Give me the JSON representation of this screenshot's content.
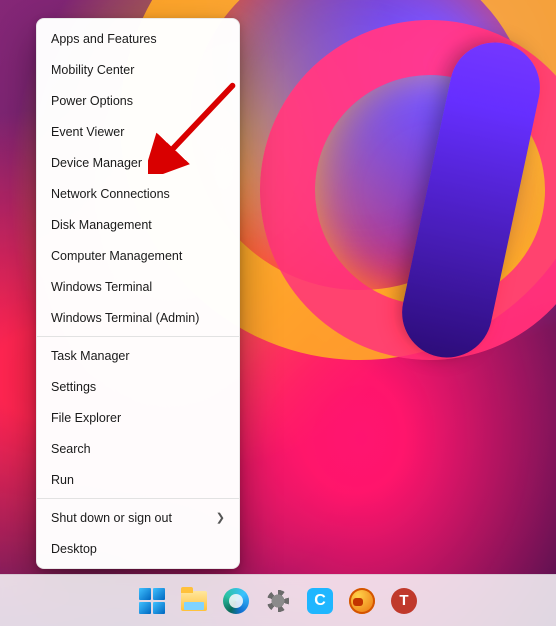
{
  "context_menu": {
    "groups": [
      [
        {
          "id": "apps-features",
          "label": "Apps and Features"
        },
        {
          "id": "mobility-center",
          "label": "Mobility Center"
        },
        {
          "id": "power-options",
          "label": "Power Options"
        },
        {
          "id": "event-viewer",
          "label": "Event Viewer"
        },
        {
          "id": "device-manager",
          "label": "Device Manager"
        },
        {
          "id": "network-connections",
          "label": "Network Connections"
        },
        {
          "id": "disk-management",
          "label": "Disk Management"
        },
        {
          "id": "computer-management",
          "label": "Computer Management"
        },
        {
          "id": "windows-terminal",
          "label": "Windows Terminal"
        },
        {
          "id": "windows-terminal-admin",
          "label": "Windows Terminal (Admin)"
        }
      ],
      [
        {
          "id": "task-manager",
          "label": "Task Manager"
        },
        {
          "id": "settings",
          "label": "Settings"
        },
        {
          "id": "file-explorer",
          "label": "File Explorer"
        },
        {
          "id": "search",
          "label": "Search"
        },
        {
          "id": "run",
          "label": "Run"
        }
      ],
      [
        {
          "id": "shut-down-sign-out",
          "label": "Shut down or sign out",
          "submenu": true
        },
        {
          "id": "desktop",
          "label": "Desktop"
        }
      ]
    ]
  },
  "annotation": {
    "target_item_id": "device-manager",
    "color": "#d90000"
  },
  "taskbar": {
    "icons": [
      {
        "id": "start",
        "name": "start-icon"
      },
      {
        "id": "file-explorer",
        "name": "file-explorer-icon"
      },
      {
        "id": "edge",
        "name": "edge-icon"
      },
      {
        "id": "settings",
        "name": "settings-icon"
      },
      {
        "id": "app-c",
        "name": "app-c-icon",
        "letter": "C"
      },
      {
        "id": "app-globe",
        "name": "app-globe-icon"
      },
      {
        "id": "app-t",
        "name": "app-t-icon",
        "letter": "T"
      }
    ]
  }
}
